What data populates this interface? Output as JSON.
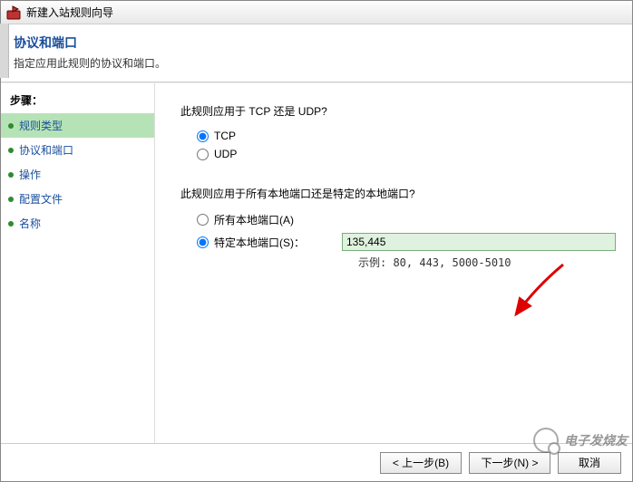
{
  "titlebar": {
    "text": "新建入站规则向导"
  },
  "header": {
    "title": "协议和端口",
    "subtitle": "指定应用此规则的协议和端口。"
  },
  "sidebar": {
    "label": "步骤：",
    "items": [
      {
        "label": "规则类型"
      },
      {
        "label": "协议和端口"
      },
      {
        "label": "操作"
      },
      {
        "label": "配置文件"
      },
      {
        "label": "名称"
      }
    ]
  },
  "content": {
    "question1": "此规则应用于 TCP 还是 UDP?",
    "tcp": "TCP",
    "udp": "UDP",
    "question2": "此规则应用于所有本地端口还是特定的本地端口?",
    "allports": "所有本地端口(A)",
    "specificports": "特定本地端口(S)：",
    "portvalue": "135,445",
    "example": "示例: 80, 443, 5000-5010"
  },
  "footer": {
    "back": "< 上一步(B)",
    "next": "下一步(N) >",
    "cancel": "取消"
  },
  "watermark": {
    "text": "电子发烧友"
  }
}
